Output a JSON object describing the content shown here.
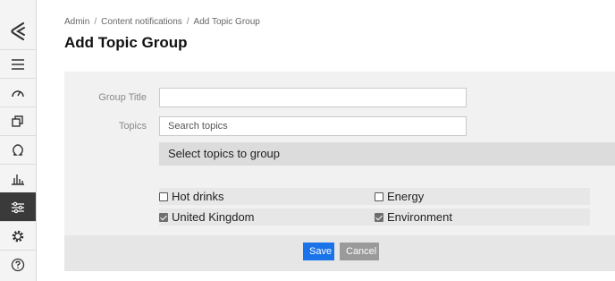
{
  "breadcrumb": [
    "Admin",
    "Content notifications",
    "Add Topic Group"
  ],
  "page_title": "Add Topic Group",
  "sidebar": {
    "items": [
      {
        "icon": "menu-icon"
      },
      {
        "icon": "dashboard-gauge-icon"
      },
      {
        "icon": "copy-icon"
      },
      {
        "icon": "omega-icon"
      },
      {
        "icon": "bar-chart-icon"
      },
      {
        "icon": "sliders-icon",
        "active": true
      },
      {
        "icon": "gear-icon"
      },
      {
        "icon": "help-icon"
      }
    ]
  },
  "form": {
    "group_title_label": "Group Title",
    "group_title_value": "",
    "topics_label": "Topics",
    "topics_placeholder": "Search topics",
    "select_header": "Select topics to group",
    "topics": [
      {
        "label": "Hot drinks",
        "checked": false
      },
      {
        "label": "Energy",
        "checked": false
      },
      {
        "label": "United Kingdom",
        "checked": true
      },
      {
        "label": "Environment",
        "checked": true
      }
    ],
    "save_label": "Save",
    "cancel_label": "Cancel"
  },
  "colors": {
    "primary": "#1a73e8",
    "cancel": "#9a9a9a",
    "sidebar_active": "#3a3a3a"
  }
}
